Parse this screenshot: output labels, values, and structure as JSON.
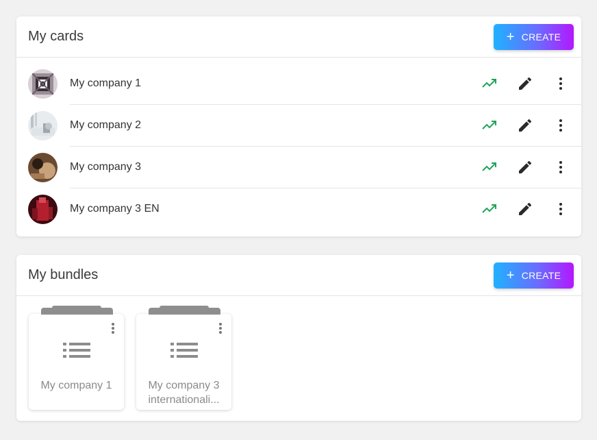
{
  "cards_panel": {
    "title": "My cards",
    "create_label": "CREATE",
    "items": [
      {
        "name": "My company 1"
      },
      {
        "name": "My company 2"
      },
      {
        "name": "My company 3"
      },
      {
        "name": "My company 3 EN"
      }
    ]
  },
  "bundles_panel": {
    "title": "My bundles",
    "create_label": "CREATE",
    "items": [
      {
        "name": "My company 1"
      },
      {
        "name": "My company 3 internationali..."
      }
    ]
  },
  "colors": {
    "trend": "#21a35a",
    "accent_start": "#1fb2ff",
    "accent_end": "#b417ff"
  },
  "icons": [
    "plus-icon",
    "trending-up-icon",
    "pencil-icon",
    "more-vert-icon",
    "list-icon"
  ]
}
